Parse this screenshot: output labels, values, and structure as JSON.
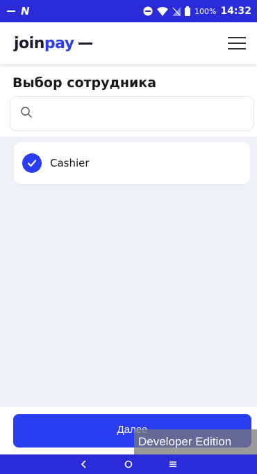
{
  "status_bar": {
    "battery_percent": "100%",
    "time": "14:32",
    "left_glyph": "N"
  },
  "header": {
    "logo_part1": "join",
    "logo_part2": "pay"
  },
  "page": {
    "title": "Выбор сотрудника"
  },
  "search": {
    "value": "",
    "placeholder": ""
  },
  "employees": [
    {
      "name": "Cashier",
      "selected": true
    }
  ],
  "footer": {
    "next_label": "Далее",
    "overlay_label": "Developer Edition"
  },
  "colors": {
    "accent": "#2b3df0",
    "system_bar": "#2b2bd9",
    "list_background": "#eef2f7"
  },
  "icons": {
    "search": "search-icon",
    "check": "check-icon",
    "menu": "menu-icon",
    "back": "back-icon",
    "home": "home-icon",
    "recents": "recents-icon"
  }
}
